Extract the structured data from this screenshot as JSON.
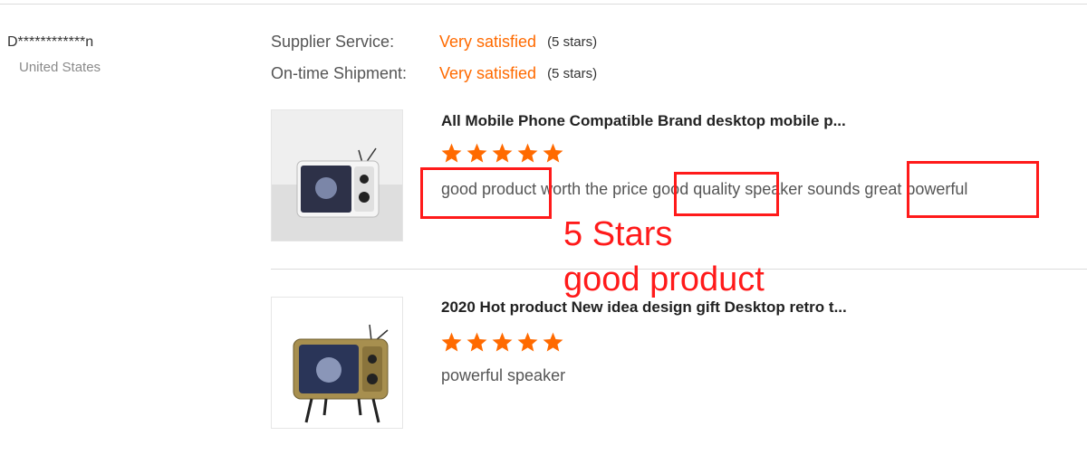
{
  "buyer": {
    "name": "D************n",
    "country": "United States"
  },
  "ratings": [
    {
      "label": "Supplier Service:",
      "value": "Very satisfied",
      "stars_text": "(5 stars)"
    },
    {
      "label": "On-time Shipment:",
      "value": "Very satisfied",
      "stars_text": "(5 stars)"
    }
  ],
  "reviews": [
    {
      "product_title": "All Mobile Phone Compatible Brand desktop mobile p...",
      "rating": 5,
      "segments": [
        "good product",
        " worth the price ",
        "good quality",
        " speaker sounds ",
        "great powerful"
      ]
    },
    {
      "product_title": "2020 Hot product New idea design gift Desktop retro t...",
      "rating": 5,
      "text": "powerful speaker"
    }
  ],
  "annotations": {
    "line1": "5 Stars",
    "line2": "good product"
  },
  "colors": {
    "accent": "#ff6a00",
    "annotation": "#ff1a1a",
    "star": "#ff6a00"
  },
  "icons": {
    "star": "star-icon"
  }
}
